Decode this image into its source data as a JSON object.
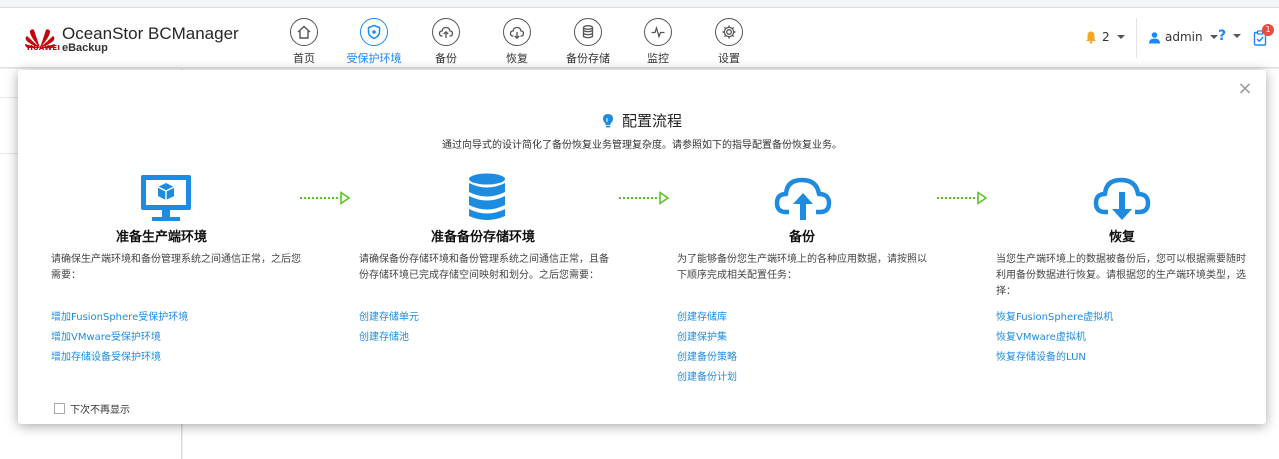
{
  "header": {
    "logo_text": "HUAWEI",
    "brand_title": "OceanStor BCManager",
    "brand_subtitle": "eBackup",
    "nav": [
      {
        "label": "首页",
        "icon": "home-icon",
        "active": false
      },
      {
        "label": "受保护环境",
        "icon": "shield-icon",
        "active": true
      },
      {
        "label": "备份",
        "icon": "cloud-upload-icon",
        "active": false
      },
      {
        "label": "恢复",
        "icon": "cloud-download-icon",
        "active": false
      },
      {
        "label": "备份存储",
        "icon": "database-icon",
        "active": false
      },
      {
        "label": "监控",
        "icon": "pulse-icon",
        "active": false
      },
      {
        "label": "设置",
        "icon": "gear-icon",
        "active": false
      }
    ],
    "alarm_count": "2",
    "user": "admin",
    "help": "?",
    "task_badge": "1",
    "accent_color": "#1989fa",
    "alarm_color": "#f5a623"
  },
  "dialog": {
    "title": "配置流程",
    "subtitle": "通过向导式的设计简化了备份恢复业务管理复杂度。请参照如下的指导配置备份恢复业务。",
    "steps": [
      {
        "icon": "monitor-icon",
        "title": "准备生产端环境",
        "desc": "请确保生产端环境和备份管理系统之间通信正常，之后您需要：",
        "links": [
          "增加FusionSphere受保护环境",
          "增加VMware受保护环境",
          "增加存储设备受保护环境"
        ]
      },
      {
        "icon": "database-icon",
        "title": "准备备份存储环境",
        "desc": "请确保备份存储环境和备份管理系统之间通信正常，且备份存储环境已完成存储空间映射和划分。之后您需要：",
        "links": [
          "创建存储单元",
          "创建存储池"
        ]
      },
      {
        "icon": "cloud-upload-icon",
        "title": "备份",
        "desc": "为了能够备份您生产端环境上的各种应用数据，请按照以下顺序完成相关配置任务：",
        "links": [
          "创建存储库",
          "创建保护集",
          "创建备份策略",
          "创建备份计划"
        ]
      },
      {
        "icon": "cloud-download-icon",
        "title": "恢复",
        "desc": "当您生产端环境上的数据被备份后，您可以根据需要随时利用备份数据进行恢复。请根据您的生产端环境类型，选择：",
        "links": [
          "恢复FusionSphere虚拟机",
          "恢复VMware虚拟机",
          "恢复存储设备的LUN"
        ]
      }
    ],
    "dont_show_label": "下次不再显示",
    "close": "×",
    "icon_color": "#1d8ce0",
    "arrow_color": "#52c41a"
  }
}
